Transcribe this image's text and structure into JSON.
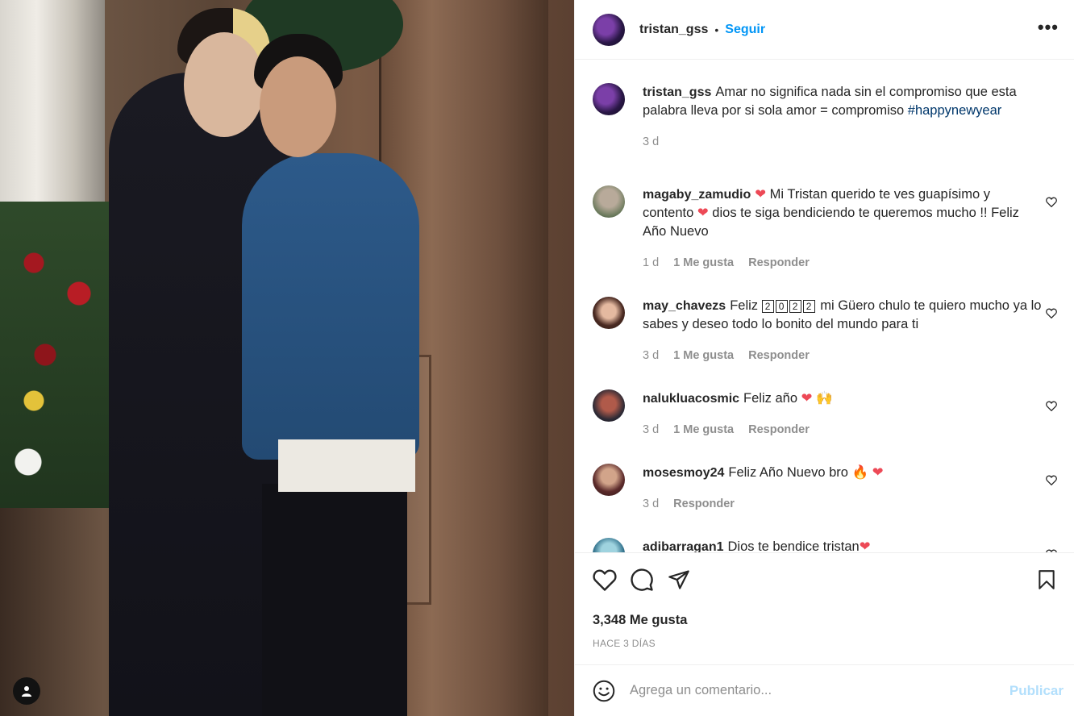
{
  "post": {
    "author": "tristan_gss",
    "follow_label": "Seguir",
    "separator": "•",
    "more_label": "•••",
    "caption_user": "tristan_gss",
    "caption_text": "Amar no significa nada sin el compromiso que esta palabra lleva por si sola amor = compromiso ",
    "caption_hashtag": "#happynewyear",
    "caption_time": "3 d"
  },
  "comments": [
    {
      "user": "magaby_zamudio",
      "heart1": "❤",
      "text_a": " Mi Tristan querido te ves guapísimo y contento ",
      "heart2": "❤",
      "text_b": " dios te siga bendiciendo te queremos mucho !! Feliz Año Nuevo",
      "time": "1 d",
      "likes": "1 Me gusta",
      "reply": "Responder"
    },
    {
      "user": "may_chavezs",
      "text_a": "Feliz ",
      "digits": [
        "2",
        "0",
        "2",
        "2"
      ],
      "text_b": " mi Güero chulo te quiero mucho ya lo sabes y deseo todo lo bonito del mundo para ti",
      "time": "3 d",
      "likes": "1 Me gusta",
      "reply": "Responder"
    },
    {
      "user": "nalukluacosmic",
      "text": "Feliz año ",
      "heart": "❤",
      "emoji": "🙌",
      "time": "3 d",
      "likes": "1 Me gusta",
      "reply": "Responder"
    },
    {
      "user": "mosesmoy24",
      "text": "Feliz Año Nuevo bro ",
      "emoji": "🔥",
      "heart": "❤",
      "time": "3 d",
      "reply": "Responder"
    },
    {
      "user": "adibarragan1",
      "text": "Dios te bendice tristan",
      "heart": "❤"
    }
  ],
  "actions": {
    "likes": "3,348 Me gusta",
    "time_ago": "HACE 3 DÍAS"
  },
  "add_comment": {
    "placeholder": "Agrega un comentario...",
    "publish_label": "Publicar"
  },
  "icons": {
    "like": "heart-outline",
    "comment": "speech-bubble",
    "share": "paper-plane",
    "save": "bookmark",
    "emoji": "smiley",
    "tags": "user-silhouette",
    "more": "three-dots"
  },
  "colors": {
    "accent": "#0095f6",
    "publish_disabled": "#b2dffc",
    "hashtag": "#00376b",
    "heart_red": "#ed4956",
    "secondary_text": "#8e8e8e"
  }
}
